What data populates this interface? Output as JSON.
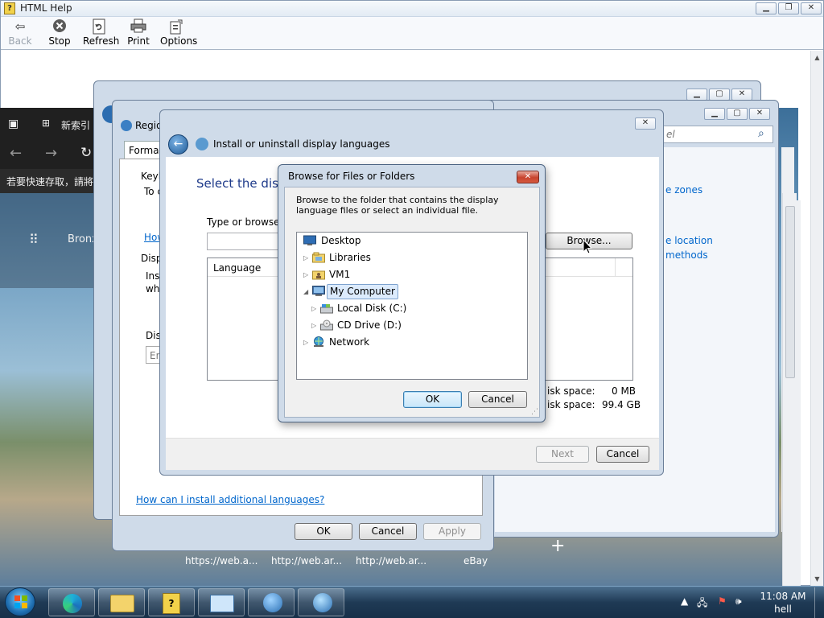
{
  "help": {
    "title": "HTML Help",
    "toolbar": [
      {
        "label": "Back",
        "icon": "back-arrow-icon",
        "disabled": true
      },
      {
        "label": "Stop",
        "icon": "stop-icon"
      },
      {
        "label": "Refresh",
        "icon": "refresh-icon"
      },
      {
        "label": "Print",
        "icon": "print-icon"
      },
      {
        "label": "Options",
        "icon": "options-icon"
      }
    ]
  },
  "browser": {
    "tab_text": "新索引",
    "fav_text": "若要快速存取，請將",
    "apps_text": "Bronx"
  },
  "control_panel": {
    "search_placeholder": "el",
    "links": [
      "e zones",
      "e location",
      "methods"
    ]
  },
  "region": {
    "title": "Regio",
    "tab_formats": "Formats",
    "keyboards_heading": "Keyb",
    "keyboards_text": "To c",
    "link_how": "How",
    "display_heading": "Disp",
    "display_text_1": "Inst",
    "display_text_2": "wh",
    "display_label": "Dis",
    "display_combo": "En",
    "footer_link": "How can I install additional languages?",
    "ok": "OK",
    "cancel": "Cancel",
    "apply": "Apply"
  },
  "install": {
    "title": "Install or uninstall display languages",
    "heading": "Select the disp",
    "prompt": "Type or browse t",
    "browse": "Browse...",
    "column_language": "Language",
    "disk1_label": "isk space:",
    "disk1_value": "0 MB",
    "disk2_label": "isk space:",
    "disk2_value": "99.4 GB",
    "next": "Next",
    "cancel": "Cancel"
  },
  "browse_dialog": {
    "title": "Browse for Files or Folders",
    "description": "Browse to the folder that contains the display language files or select an individual file.",
    "tree": [
      {
        "label": "Desktop",
        "icon": "desktop-icon"
      },
      {
        "label": "Libraries",
        "icon": "libraries-icon"
      },
      {
        "label": "VM1",
        "icon": "user-folder-icon"
      },
      {
        "label": "My Computer",
        "icon": "computer-icon"
      },
      {
        "label": "Local Disk (C:)",
        "icon": "hard-disk-icon"
      },
      {
        "label": "CD Drive (D:)",
        "icon": "cd-drive-icon"
      },
      {
        "label": "Network",
        "icon": "network-icon"
      }
    ],
    "ok": "OK",
    "cancel": "Cancel"
  },
  "desktop_links": [
    "https://web.a...",
    "http://web.ar...",
    "http://web.ar...",
    "eBay"
  ],
  "taskbar": {
    "time": "11:08 AM",
    "user": "hell"
  }
}
